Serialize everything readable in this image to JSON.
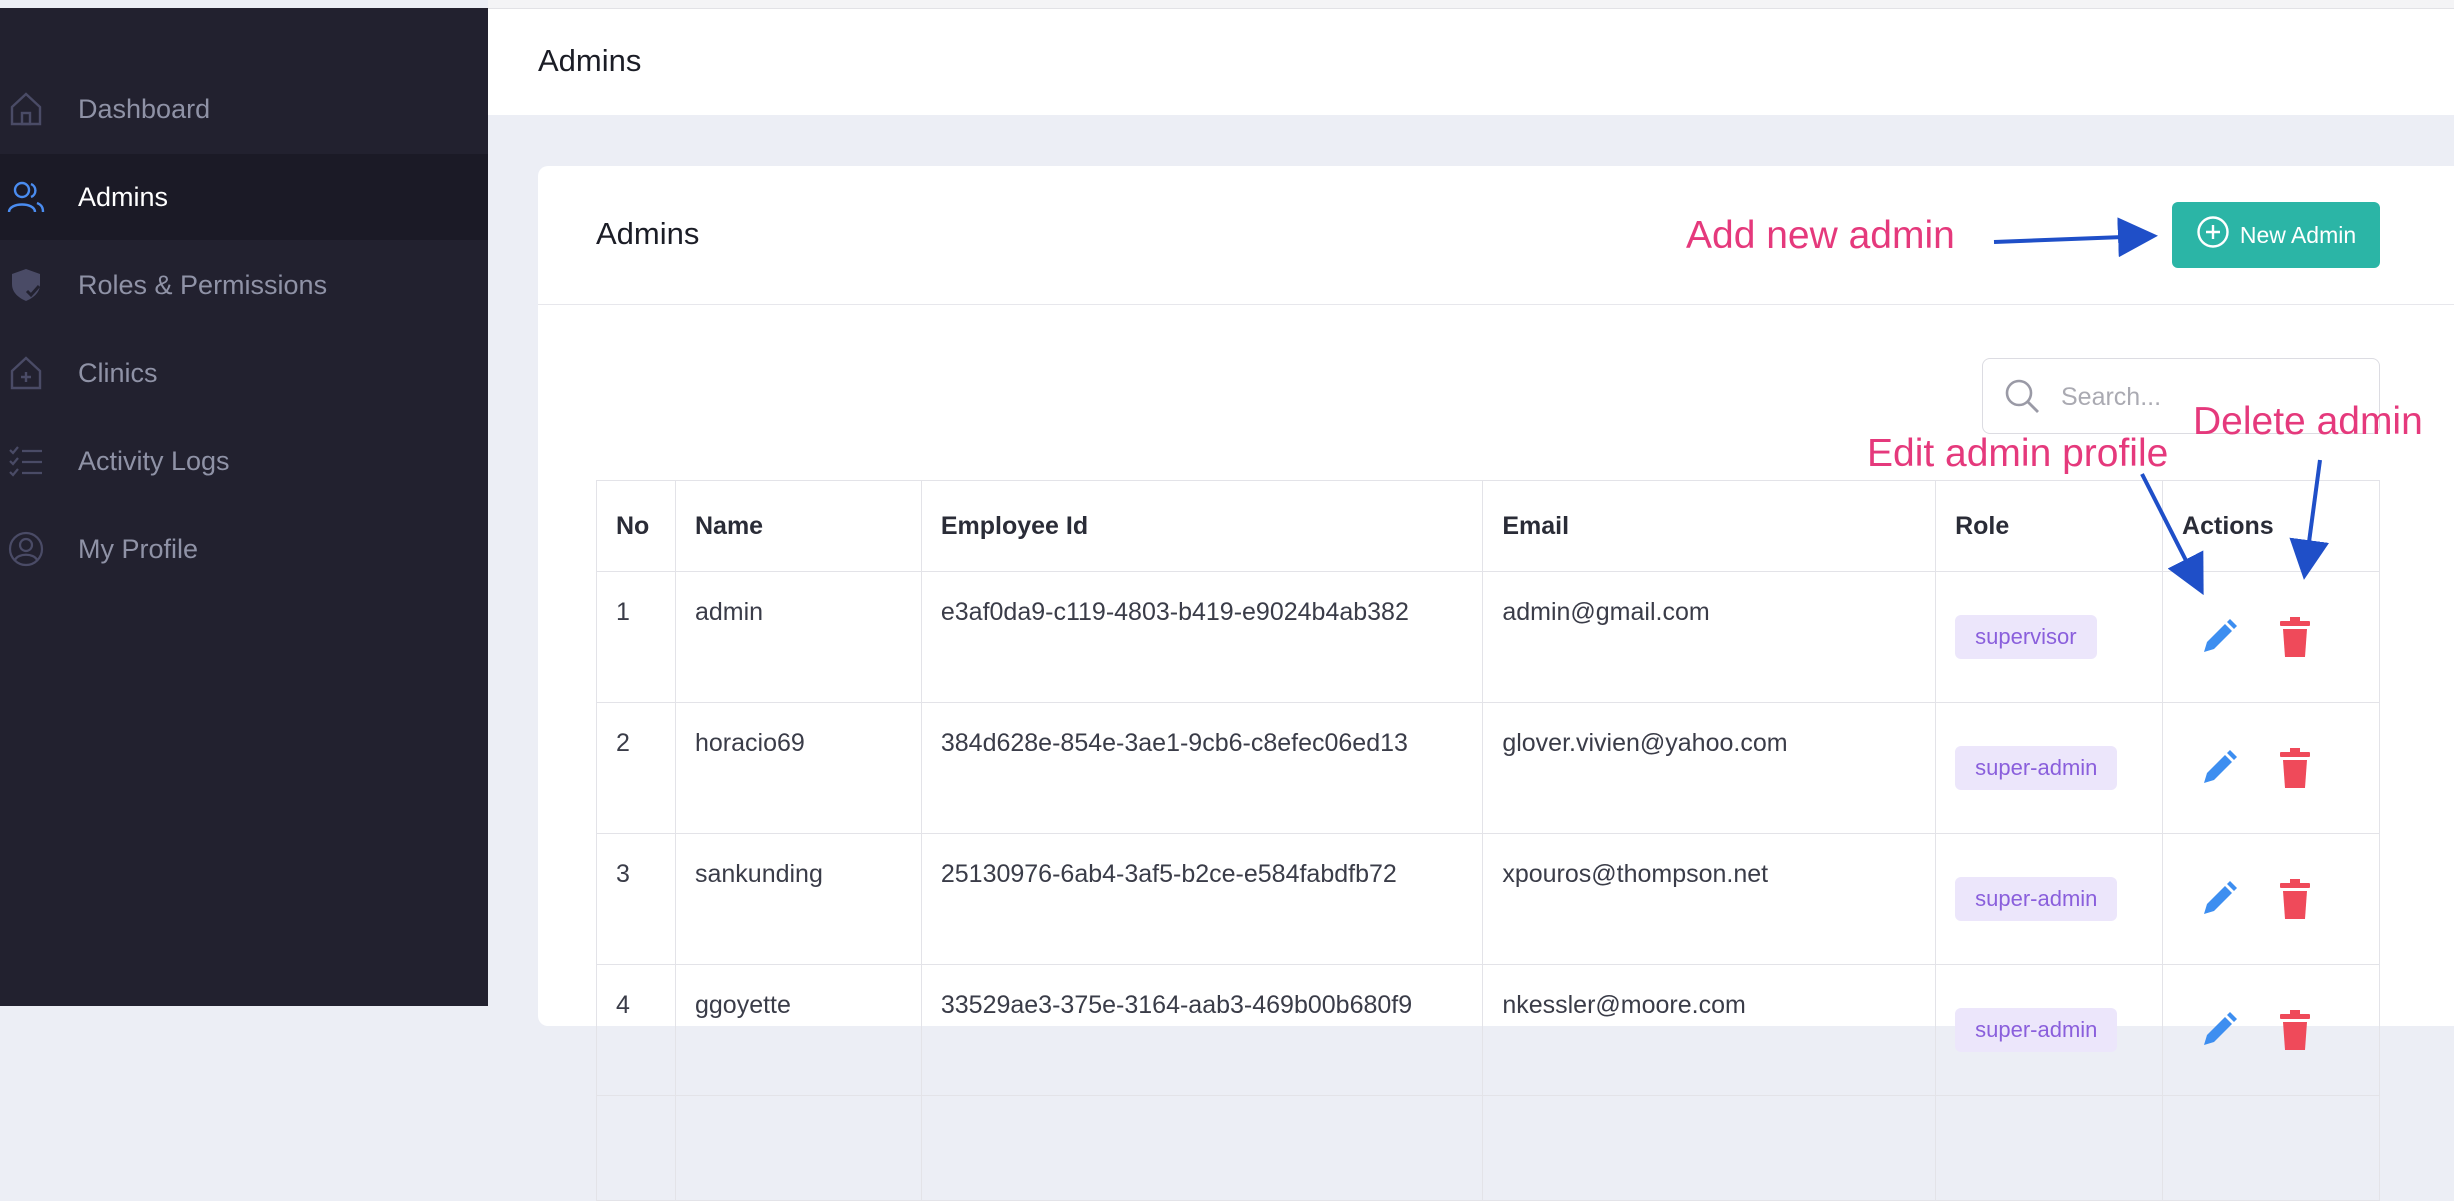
{
  "sidebar": {
    "items": [
      {
        "label": "Dashboard",
        "icon": "home-icon"
      },
      {
        "label": "Admins",
        "icon": "users-icon"
      },
      {
        "label": "Roles & Permissions",
        "icon": "shield-icon"
      },
      {
        "label": "Clinics",
        "icon": "clinic-icon"
      },
      {
        "label": "Activity Logs",
        "icon": "list-icon"
      },
      {
        "label": "My Profile",
        "icon": "profile-icon"
      }
    ],
    "active": "Admins"
  },
  "header": {
    "title": "Admins"
  },
  "card": {
    "title": "Admins",
    "new_button_label": "New Admin"
  },
  "search": {
    "placeholder": "Search..."
  },
  "table": {
    "columns": [
      "No",
      "Name",
      "Employee Id",
      "Email",
      "Role",
      "Actions"
    ],
    "rows": [
      {
        "no": "1",
        "name": "admin",
        "employee_id": "e3af0da9-c119-4803-b419-e9024b4ab382",
        "email": "admin@gmail.com",
        "role": "supervisor"
      },
      {
        "no": "2",
        "name": "horacio69",
        "employee_id": "384d628e-854e-3ae1-9cb6-c8efec06ed13",
        "email": "glover.vivien@yahoo.com",
        "role": "super-admin"
      },
      {
        "no": "3",
        "name": "sankunding",
        "employee_id": "25130976-6ab4-3af5-b2ce-e584fabdfb72",
        "email": "xpouros@thompson.net",
        "role": "super-admin"
      },
      {
        "no": "4",
        "name": "ggoyette",
        "employee_id": "33529ae3-375e-3164-aab3-469b00b680f9",
        "email": "nkessler@moore.com",
        "role": "super-admin"
      }
    ]
  },
  "annotations": {
    "add": "Add new admin",
    "edit": "Edit admin profile",
    "delete": "Delete admin"
  },
  "colors": {
    "sidebar_bg": "#22212f",
    "accent": "#2bb5a6",
    "edit_icon": "#3d8ef0",
    "delete_icon": "#ef4a5a",
    "annotation": "#e5397c",
    "arrow": "#1f4fc8",
    "badge_bg": "#ece6fb",
    "badge_text": "#8a5fdc"
  }
}
